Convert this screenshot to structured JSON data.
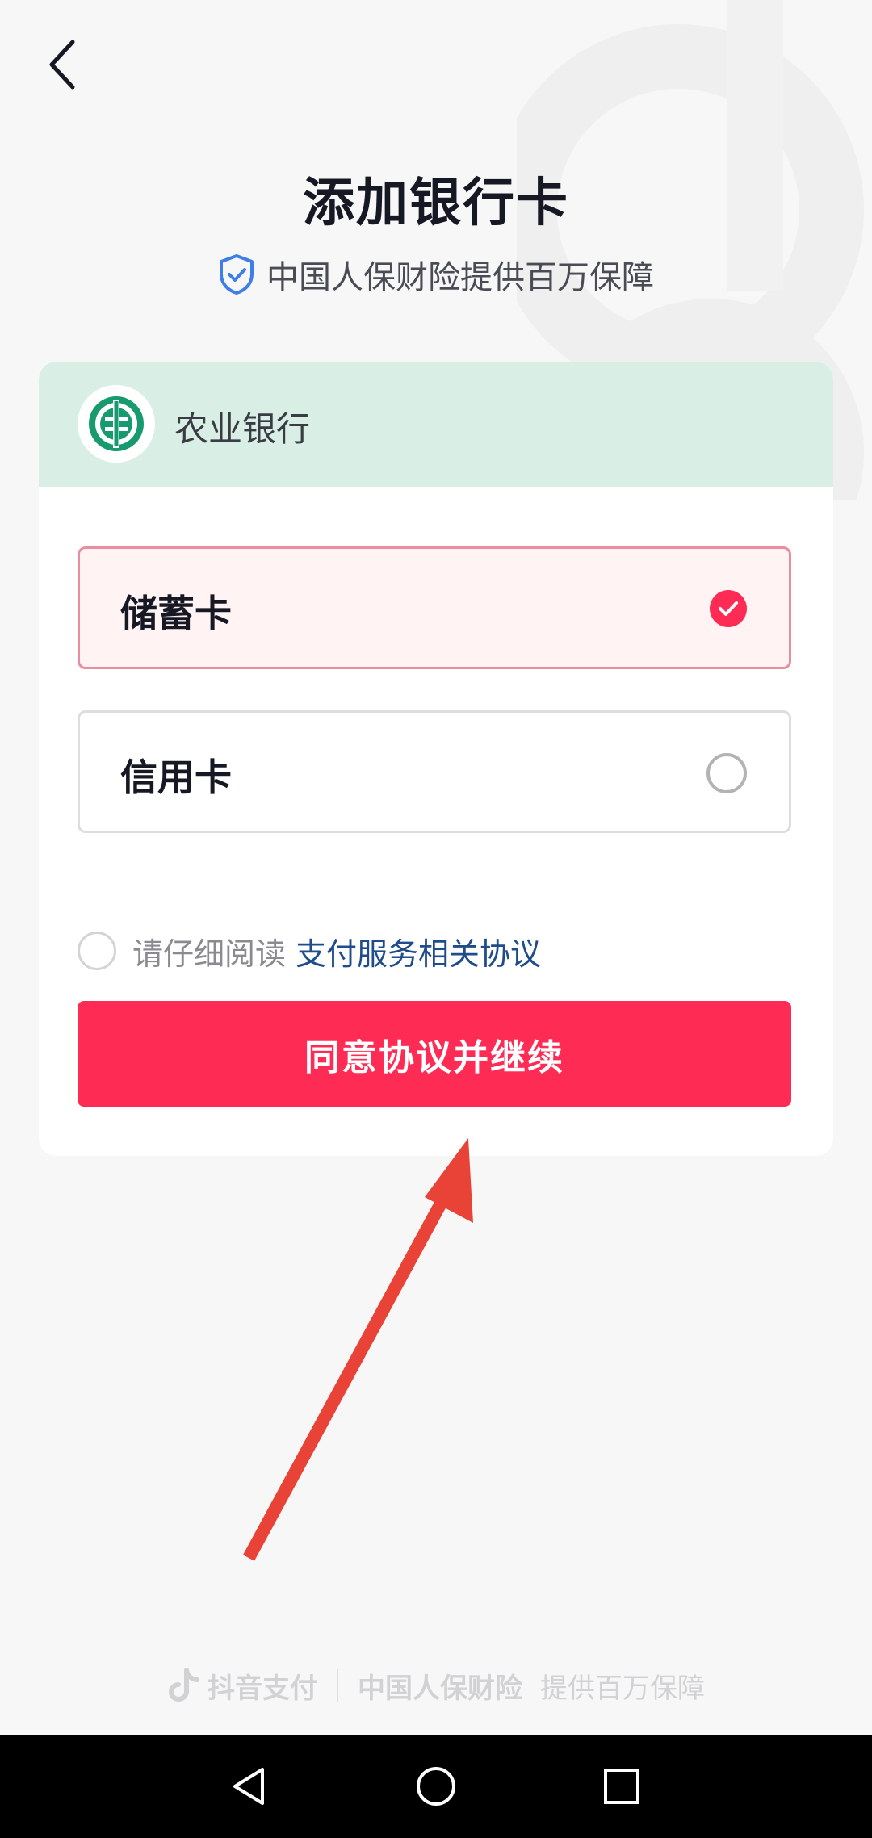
{
  "header": {
    "back_icon": "chevron-left-icon",
    "title": "添加银行卡",
    "subtitle": "中国人保财险提供百万保障",
    "subtitle_icon": "shield-check-icon"
  },
  "bank": {
    "name": "农业银行",
    "logo_icon": "abc-bank-logo-icon"
  },
  "card_types": [
    {
      "label": "储蓄卡",
      "selected": true
    },
    {
      "label": "信用卡",
      "selected": false
    }
  ],
  "agreement": {
    "prefix": "请仔细阅读",
    "link": "支付服务相关协议",
    "checked": false
  },
  "continue_label": "同意协议并继续",
  "footer": {
    "brand": "抖音支付",
    "insurer": "中国人保财险",
    "claim": "提供百万保障"
  },
  "navbar": {
    "back_icon": "nav-back-icon",
    "home_icon": "nav-home-icon",
    "recents_icon": "nav-recents-icon"
  },
  "colors": {
    "accent": "#fe2c55",
    "bank_header_bg": "#d9efe5",
    "bank_green": "#169a6e",
    "link": "#1f4c8a",
    "annotation_arrow": "#e94338"
  }
}
